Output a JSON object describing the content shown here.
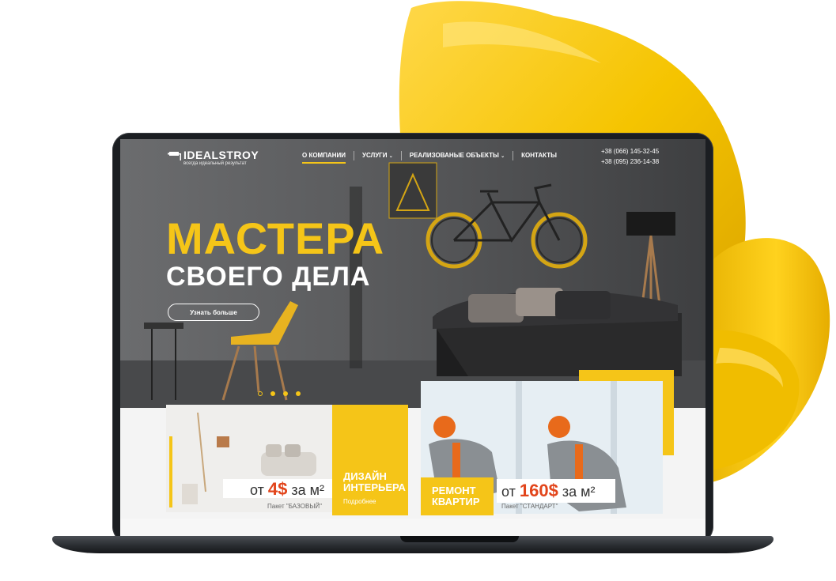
{
  "site": {
    "logo_name": "IDEALSTROY",
    "logo_tagline": "всегда идеальный результат",
    "nav": [
      {
        "label": "О КОМПАНИИ",
        "active": true,
        "has_dropdown": false
      },
      {
        "label": "УСЛУГИ",
        "active": false,
        "has_dropdown": true
      },
      {
        "label": "РЕАЛИЗОВАНЫЕ ОБЪЕКТЫ",
        "active": false,
        "has_dropdown": true
      },
      {
        "label": "КОНТАКТЫ",
        "active": false,
        "has_dropdown": false
      }
    ],
    "phones": [
      "+38 (066) 145-32-45",
      "+38 (095) 236-14-38"
    ]
  },
  "hero": {
    "title_line1": "МАСТЕРА",
    "title_line2": "СВОЕГО ДЕЛА",
    "button_label": "Узнать больше",
    "slides_count": 4,
    "active_slide": 1
  },
  "cards": {
    "design": {
      "price_prefix": "от",
      "price_value": "4$",
      "price_suffix": "за м²",
      "package": "Пакет \"БАЗОВЫЙ\"",
      "title": "ДИЗАЙН ИНТЕРЬЕРА",
      "link": "Подробнее"
    },
    "repair": {
      "title": "РЕМОНТ КВАРТИР",
      "price_prefix": "от",
      "price_value": "160$",
      "price_suffix": "за м²",
      "package": "Пакет \"СТАНДАРТ\""
    }
  },
  "colors": {
    "accent": "#f5c518",
    "price": "#e2451b",
    "chair": "#f7c600"
  },
  "icons": [
    "paint-roller-icon",
    "chevron-down-icon"
  ]
}
